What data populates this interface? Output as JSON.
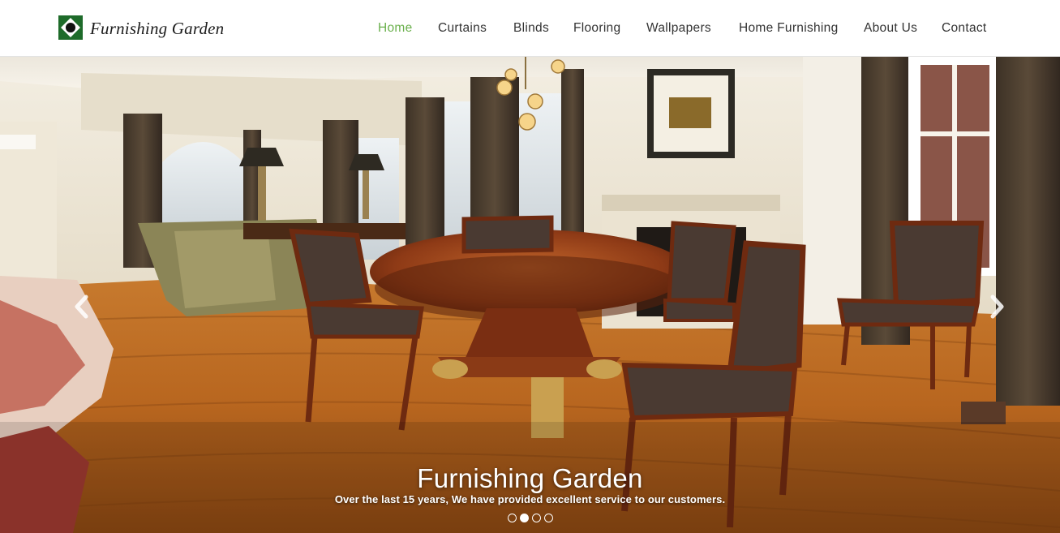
{
  "brand": {
    "name": "Furnishing Garden",
    "logo_icon": "diamond-logo-icon",
    "logo_color": "#1e6b2a"
  },
  "nav": {
    "active_color": "#6ab04c",
    "items": [
      {
        "label": "Home",
        "active": true
      },
      {
        "label": "Curtains",
        "active": false
      },
      {
        "label": "Blinds",
        "active": false
      },
      {
        "label": "Flooring",
        "active": false
      },
      {
        "label": "Wallpapers",
        "active": false
      },
      {
        "label": "Home Furnishing",
        "active": false
      },
      {
        "label": "About Us",
        "active": false
      },
      {
        "label": "Contact",
        "active": false
      }
    ]
  },
  "hero": {
    "title": "Furnishing Garden",
    "subtitle": "Over the last 15 years, We have provided excellent service to our customers.",
    "prev_icon": "chevron-left-icon",
    "next_icon": "chevron-right-icon",
    "slide_count": 4,
    "active_slide": 2
  }
}
